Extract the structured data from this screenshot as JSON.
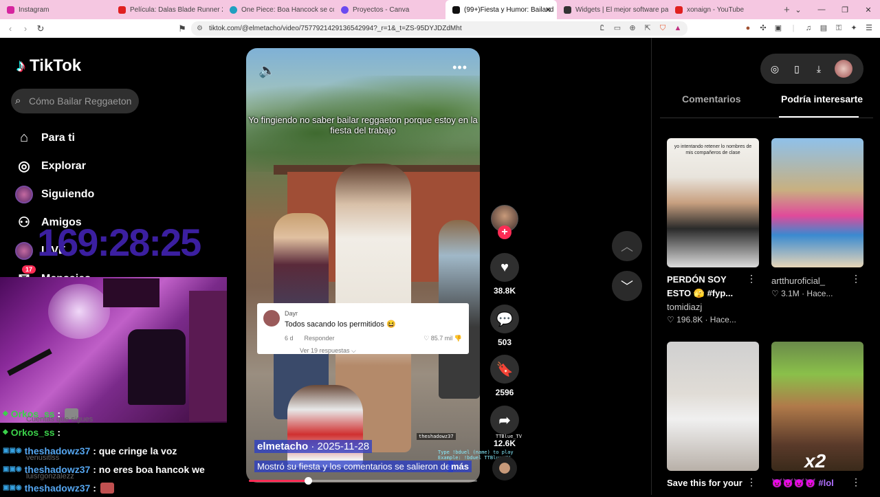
{
  "browser": {
    "tabs": [
      {
        "label": "Instagram",
        "color": "#d6249f"
      },
      {
        "label": "Película: Dalas Blade Runner 2077 - Y",
        "color": "#e02020"
      },
      {
        "label": "One Piece: Boa Hancock se convierte",
        "color": "#20a0c0"
      },
      {
        "label": "Proyectos - Canva",
        "color": "#6a4af0"
      },
      {
        "label": "(99+)Fiesta y Humor: Bailand",
        "color": "#111111"
      },
      {
        "label": "Widgets | El mejor software para pot",
        "color": "#333333"
      },
      {
        "label": "xonaign - YouTube",
        "color": "#e02020"
      }
    ],
    "active_tab": 4,
    "new_tab": "+",
    "window_controls": [
      "⌄",
      "—",
      "❐",
      "✕"
    ],
    "url": "tiktok.com/@elmetacho/video/7577921429136542994?_r=1&_t=ZS-95DYJDZdMht"
  },
  "sidebar": {
    "logo": "TikTok",
    "search_placeholder": "Cómo Bailar Reggaeton",
    "nav": [
      {
        "label": "Para ti",
        "icon": "home-icon"
      },
      {
        "label": "Explorar",
        "icon": "compass-icon"
      },
      {
        "label": "Siguiendo",
        "icon": "following-avatar"
      },
      {
        "label": "Amigos",
        "icon": "friends-icon"
      },
      {
        "label": "LIVE",
        "icon": "live-avatar"
      },
      {
        "label": "Mensajes",
        "icon": "messages-icon"
      }
    ],
    "messages_badge": "17"
  },
  "stream_overlay": {
    "timer": "169:28:25",
    "chat": [
      {
        "user": "Orkos_ss",
        "sep": ":",
        "text": "",
        "emote": "grey",
        "ghost": "Cuentas que sigues"
      },
      {
        "user": "Orkos_ss",
        "sep": ":",
        "text": "",
        "emote": "",
        "ghost": ""
      },
      {
        "user": "theshadowz37",
        "sep": ":",
        "text": "que cringe la voz",
        "emote": "",
        "ghost": "venusitlss"
      },
      {
        "user": "theshadowz37",
        "sep": ":",
        "text": "no eres boa hancok we",
        "emote": "",
        "ghost": "luisrgonzalezz"
      },
      {
        "user": "theshadowz37",
        "sep": ":",
        "text": "",
        "emote": "red",
        "ghost": "luisrgonzalezz"
      }
    ]
  },
  "video": {
    "caption": "Yo fingiendo no saber bailar reggaeton porque estoy en la fiesta del trabajo",
    "comment": {
      "author": "Dayr",
      "text": "Todos sacando los permitidos 😆",
      "age": "6 d",
      "reply": "Responder",
      "likes": "85.7 mil",
      "replies": "Ver 19 respuestas ⌵"
    },
    "author": "elmetacho",
    "date": "· 2025-11-28",
    "description": "Mostró su fiesta y los comentarios se salieron de",
    "more": "más",
    "progress": 0.26,
    "overlay_top_left": "theshadowz37",
    "overlay_top_right": "TTBlue_TV",
    "overlay_type": "Type !bduel (name) to play",
    "overlay_example": "Example: !bduel TTBlue_TV"
  },
  "actions": {
    "likes": "38.8K",
    "comments": "503",
    "saves": "2596",
    "shares": "12.6K"
  },
  "right_panel": {
    "tabs": [
      "Comentarios",
      "Podría interesarte"
    ],
    "active_tab": 1,
    "cards": [
      {
        "thumb_text": "yo intentando retener lo nombres de mis compañeros de clase",
        "title": "PERDÓN SOY ESTO 🫣 #fyp...",
        "author": "tomidiazj",
        "stats": "♡ 196.8K · Hace..."
      },
      {
        "thumb_text": "",
        "title": "",
        "author": "artthuroficial_",
        "stats": "♡ 3.1M · Hace..."
      },
      {
        "thumb_text": "",
        "title": "Save this for your",
        "author": "",
        "stats": ""
      },
      {
        "thumb_text": "",
        "title": "😈😈😈😈 #lol",
        "author": "",
        "stats": "",
        "badge": "x2"
      }
    ]
  }
}
